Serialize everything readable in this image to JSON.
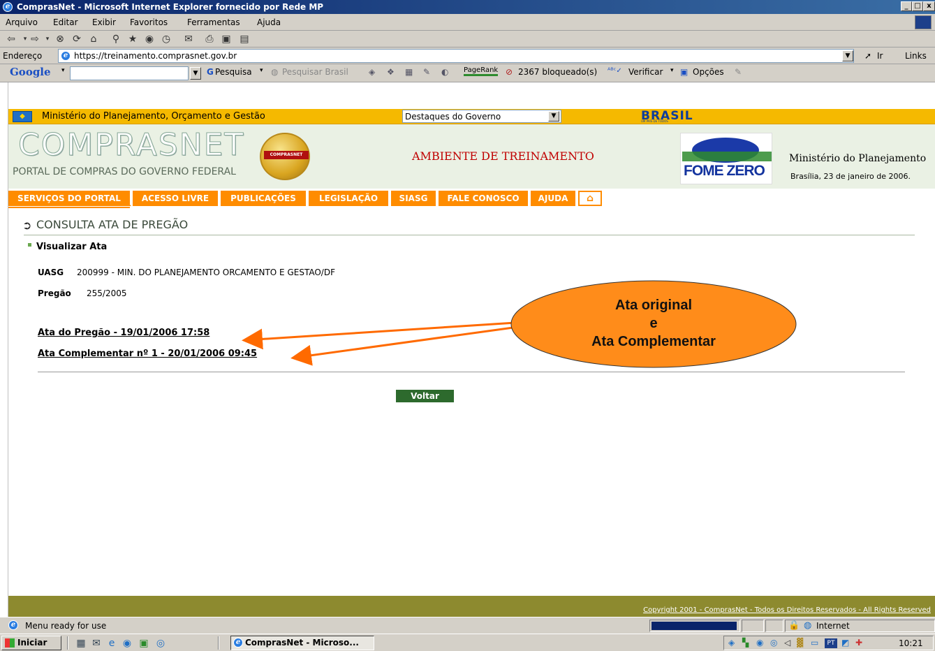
{
  "window": {
    "title": "ComprasNet - Microsoft Internet Explorer fornecido por Rede MP",
    "controls": [
      "_",
      "Š",
      "x"
    ]
  },
  "menu": [
    "Arquivo",
    "Editar",
    "Exibir",
    "Favoritos",
    "Ferramentas",
    "Ajuda"
  ],
  "address": {
    "label": "Endereço",
    "url": "https://treinamento.comprasnet.gov.br",
    "go_label": "Ir",
    "links_label": "Links"
  },
  "google_toolbar": {
    "logo": "Google",
    "search_label": "Pesquisa",
    "search_brasil_label": "Pesquisar Brasil",
    "pagerank_label": "PageRank",
    "blocked_label": "2367 bloqueado(s)",
    "spell_label": "Verificar",
    "options_label": "Opções"
  },
  "gov_strip": {
    "ministry": "Ministério do Planejamento, Orçamento e Gestão",
    "dropdown_value": "Destaques do Governo",
    "brasil_logo": "BRASIL",
    "brasil_tagline": "UM PAÍS DE TODOS"
  },
  "header": {
    "logo": "COMPRASNET",
    "logo_subtitle": "PORTAL DE COMPRAS DO GOVERNO FEDERAL",
    "seal_text": "COMPRASNET",
    "environment": "AMBIENTE DE TREINAMENTO",
    "fome_zero": "FOME ZERO",
    "ministry": "Ministério do Planejamento",
    "date": "Brasília, 23 de janeiro de 2006."
  },
  "nav": [
    "SERVIÇOS DO PORTAL",
    "ACESSO LIVRE",
    "PUBLICAÇÕES",
    "LEGISLAÇÃO",
    "SIASG",
    "FALE CONOSCO",
    "AJUDA"
  ],
  "page": {
    "heading": "CONSULTA ATA DE PREGÃO",
    "section": "Visualizar Ata",
    "uasg_label": "UASG",
    "uasg_value": "200999 - MIN. DO PLANEJAMENTO ORCAMENTO E GESTAO/DF",
    "pregao_label": "Pregão",
    "pregao_value": "255/2005",
    "link_ata": "Ata do Pregão - 19/01/2006 17:58",
    "link_complementar": "Ata Complementar nº 1 - 20/01/2006 09:45",
    "back_button": "Voltar"
  },
  "callout": {
    "line1": "Ata original",
    "line2": "e",
    "line3": "Ata Complementar",
    "color": "#ff8c1a"
  },
  "footer": {
    "copyright": "Copyright 2001 - ComprasNet - Todos os Direitos Reservados - All Rights Reserved"
  },
  "status": {
    "text": "Menu ready for use",
    "zone": "Internet"
  },
  "taskbar": {
    "start": "Iniciar",
    "task": "ComprasNet - Microso...",
    "lang": "PT",
    "time": "10:21"
  }
}
